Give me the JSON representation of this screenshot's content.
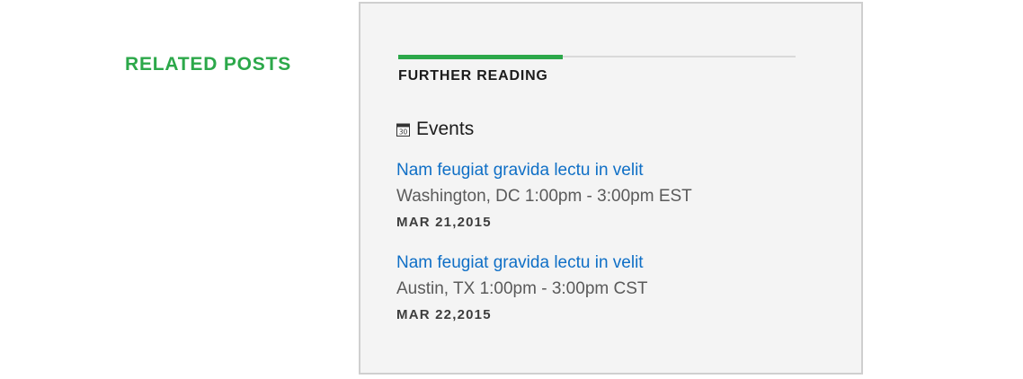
{
  "related": {
    "heading": "RELATED POSTS"
  },
  "card": {
    "tab_title": "FURTHER READING",
    "events_title": "Events",
    "calendar_icon": "calendar-icon",
    "calendar_day": "30",
    "events": [
      {
        "title": "Nam feugiat gravida lectu in velit",
        "meta": "Washington, DC 1:00pm - 3:00pm EST",
        "date": "MAR 21,2015"
      },
      {
        "title": "Nam feugiat gravida lectu in velit",
        "meta": "Austin, TX 1:00pm - 3:00pm CST",
        "date": "MAR 22,2015"
      }
    ]
  },
  "colors": {
    "accent_green": "#2ca84a",
    "link_blue": "#0f6fc6",
    "card_background": "#f4f4f4"
  }
}
